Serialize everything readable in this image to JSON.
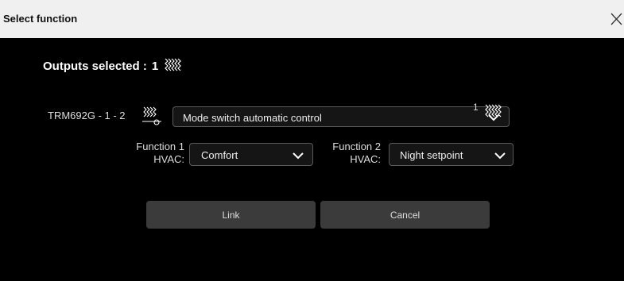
{
  "dialog": {
    "title": "Select function",
    "close_icon": "close-icon"
  },
  "outputs": {
    "label": "Outputs selected :",
    "count": "1",
    "icon": "heating-wave-icon"
  },
  "device": {
    "label": "TRM692G - 1 - 2",
    "icon": "heating-output-icon",
    "mode_select": {
      "value": "Mode switch automatic control",
      "count": "1",
      "icon": "heating-wave-icon"
    }
  },
  "functions": [
    {
      "label_line1": "Function 1",
      "label_line2": "HVAC:",
      "value": "Comfort"
    },
    {
      "label_line1": "Function 2",
      "label_line2": "HVAC:",
      "value": "Night setpoint"
    }
  ],
  "buttons": {
    "link": "Link",
    "cancel": "Cancel"
  },
  "colors": {
    "titlebar": "#f0f0f0",
    "body": "#000000",
    "button": "#3b3b3b",
    "select_border": "#5a5a5a"
  }
}
